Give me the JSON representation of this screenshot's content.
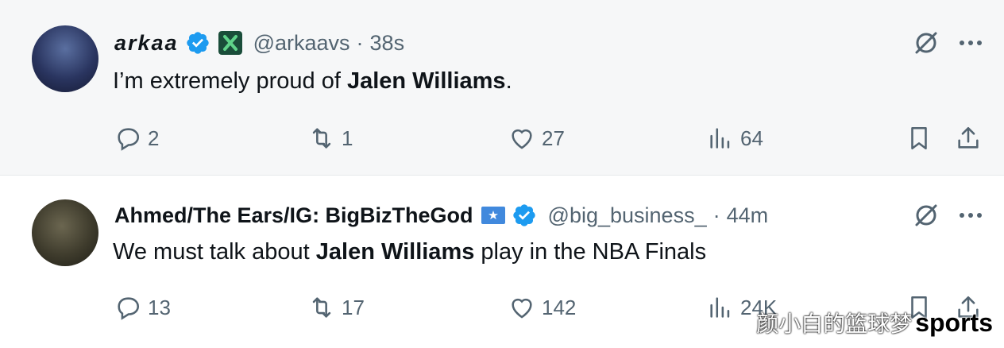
{
  "tweets": [
    {
      "author_name": "arkaa",
      "handle": "@arkaavs",
      "separator": "·",
      "time": "38s",
      "text_before": "I’m extremely proud of ",
      "text_bold": "Jalen Williams",
      "text_after": ".",
      "replies": "2",
      "retweets": "1",
      "likes": "27",
      "views": "64",
      "affiliate_badge_color": "#1a4d3a"
    },
    {
      "author_name": "Ahmed/The Ears/IG: BigBizTheGod",
      "handle": "@big_business_",
      "separator": "·",
      "time": "44m",
      "text_before": "We must talk about ",
      "text_bold": "Jalen Williams",
      "text_after": " play in the NBA Finals",
      "replies": "13",
      "retweets": "17",
      "likes": "142",
      "views": "24K",
      "affiliate_badge_color": "#4189dd"
    }
  ],
  "watermark": {
    "cn_text": "颜小白的篮球梦",
    "en_text": "sports"
  },
  "colors": {
    "verified_blue": "#1d9bf0",
    "muted_text": "#536471",
    "primary_text": "#0f1419"
  }
}
